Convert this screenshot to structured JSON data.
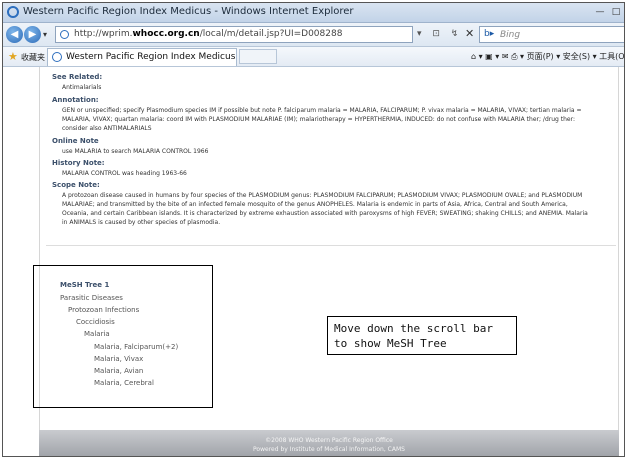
{
  "window": {
    "title": "Western Pacific Region Index Medicus - Windows Internet Explorer"
  },
  "nav": {
    "url_prefix": "http://wprim.",
    "url_domain": "whocc.org.cn",
    "url_suffix": "/local/m/detail.jsp?UI=D008288",
    "search_placeholder": "Bing"
  },
  "favorites": {
    "label": "收藏夹",
    "tab_title": "Western Pacific Region Index Medicus",
    "tools_text": "页面(P) ▾  安全(S) ▾  工具(O)"
  },
  "sections": [
    {
      "heading": "See Related:",
      "text": "Antimalarials"
    },
    {
      "heading": "Annotation:",
      "text": "GEN or unspecified; specify Plasmodium species IM if possible but note P. falciparum malaria = MALARIA, FALCIPARUM; P. vivax malaria = MALARIA, VIVAX; tertian malaria = MALARIA, VIVAX; quartan malaria: coord IM with PLASMODIUM MALARIAE (IM); malariotherapy = HYPERTHERMIA, INDUCED: do not confuse with MALARIA ther; /drug ther: consider also ANTIMALARIALS"
    },
    {
      "heading": "Online Note",
      "text": "use MALARIA to search MALARIA CONTROL 1966"
    },
    {
      "heading": "History Note:",
      "text": "MALARIA CONTROL was heading 1963-66"
    },
    {
      "heading": "Scope Note:",
      "text": "A protozoan disease caused in humans by four species of the PLASMODIUM genus: PLASMODIUM FALCIPARUM; PLASMODIUM VIVAX; PLASMODIUM OVALE; and PLASMODIUM MALARIAE; and transmitted by the bite of an infected female mosquito of the genus ANOPHELES. Malaria is endemic in parts of Asia, Africa, Central and South America, Oceania, and certain Caribbean islands. It is characterized by extreme exhaustion associated with paroxysms of high FEVER; SWEATING; shaking CHILLS; and ANEMIA. Malaria in ANIMALS is caused by other species of plasmodia."
    }
  ],
  "mesh": {
    "heading": "MeSH Tree 1",
    "items": [
      {
        "label": "Parasitic Diseases"
      },
      {
        "label": "Protozoan Infections"
      },
      {
        "label": "Coccidiosis"
      },
      {
        "label": "Malaria"
      },
      {
        "label": "Malaria, Falciparum(+2)"
      },
      {
        "label": "Malaria, Vivax"
      },
      {
        "label": "Malaria, Avian"
      },
      {
        "label": "Malaria, Cerebral"
      }
    ]
  },
  "callout": {
    "line1": "Move down the scroll bar",
    "line2": "to show MeSH Tree"
  },
  "footer": {
    "line1": "©2008 WHO Western Pacific Region Office",
    "line2": "Powered by Institute of Medical Information, CAMS"
  }
}
